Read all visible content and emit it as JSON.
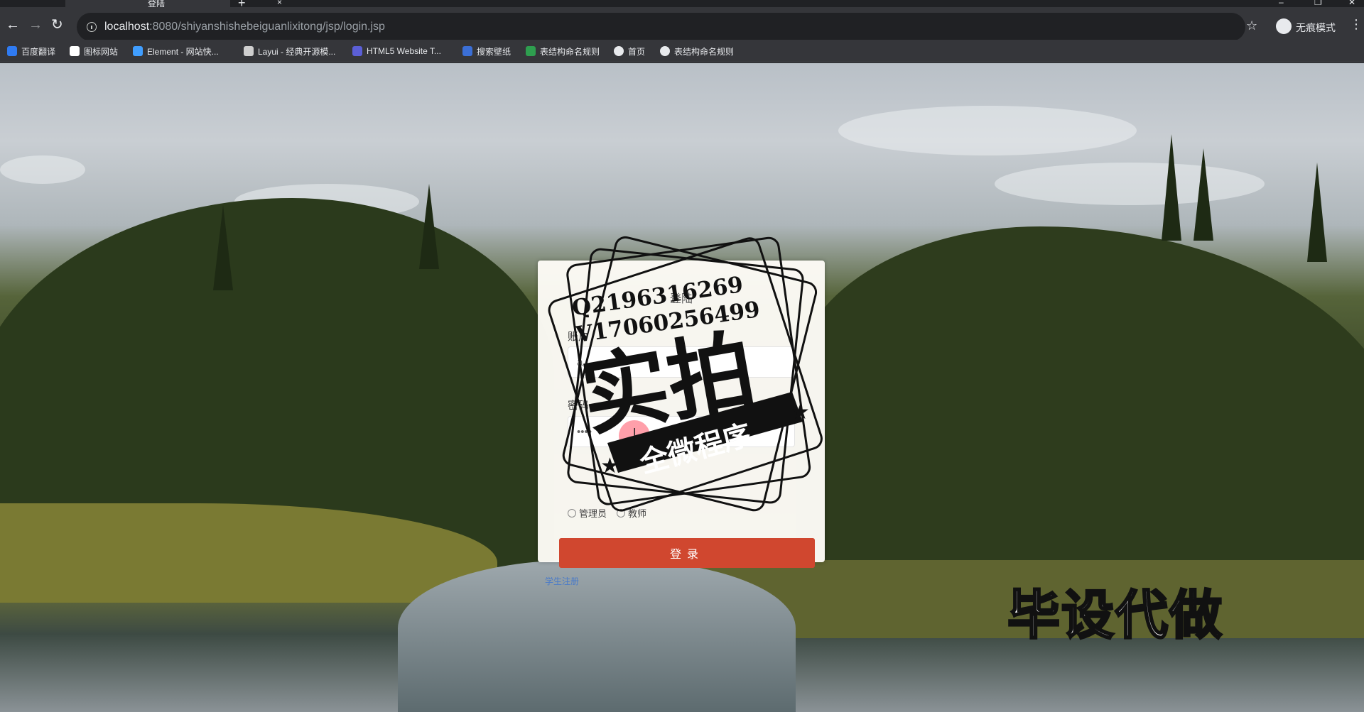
{
  "browser": {
    "tab_title": "登陆",
    "tab_close": "×",
    "new_tab": "+",
    "url_host": "localhost",
    "url_rest": ":8080/shiyanshishebeiguanlixitong/jsp/login.jsp",
    "incognito_label": "无痕模式",
    "bookmarks": [
      {
        "label": "百度翻译",
        "color": "#2f7bf2"
      },
      {
        "label": "图标网站",
        "color": "#ffffff"
      },
      {
        "label": "Element - 网站快...",
        "color": "#409eff"
      },
      {
        "label": "Layui - 经典开源模...",
        "color": "#cfcfcf"
      },
      {
        "label": "HTML5 Website T...",
        "color": "#5b5fd6"
      },
      {
        "label": "搜索壁纸",
        "color": "#3b6fd6"
      },
      {
        "label": "表结构命名规则",
        "color": "#2e9e4f"
      },
      {
        "label": "首页",
        "color": "#e8eaed"
      },
      {
        "label": "表结构命名规则",
        "color": "#e8eaed"
      }
    ]
  },
  "login": {
    "title": "登陆",
    "account_label": "账户",
    "account_value": "a",
    "password_label": "密码",
    "password_value": "••••",
    "roles": [
      "管理员",
      "教师"
    ],
    "login_button": "登录",
    "register_link": "学生注册"
  },
  "watermark": {
    "qq": "Q2196316269",
    "vx": "V17060256499",
    "big": "实拍",
    "banner": "全微程序",
    "corner": "毕设代做"
  },
  "colors": {
    "login_button": "#d0472f",
    "register_link": "#4a7bc8"
  }
}
